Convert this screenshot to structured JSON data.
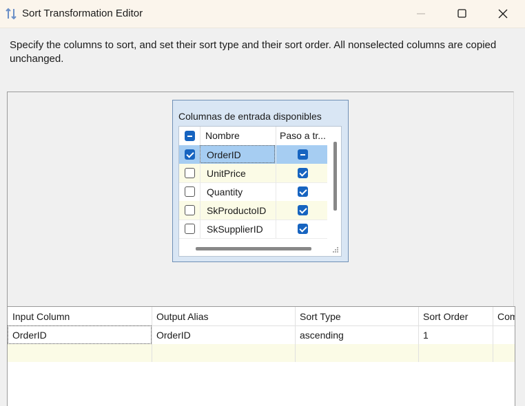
{
  "window": {
    "title": "Sort Transformation Editor"
  },
  "description": "Specify the columns to sort, and set their sort type and their sort order. All nonselected columns are copied unchanged.",
  "available_columns": {
    "title": "Columnas de entrada disponibles",
    "header_name": "Nombre",
    "header_pass": "Paso a tr...",
    "select_all_state": "indeterminate",
    "rows": [
      {
        "name": "OrderID",
        "checked": true,
        "pass_through": "indeterminate",
        "selected": true
      },
      {
        "name": "UnitPrice",
        "checked": false,
        "pass_through": "checked",
        "selected": false
      },
      {
        "name": "Quantity",
        "checked": false,
        "pass_through": "checked",
        "selected": false
      },
      {
        "name": "SkProductoID",
        "checked": false,
        "pass_through": "checked",
        "selected": false
      },
      {
        "name": "SkSupplierID",
        "checked": false,
        "pass_through": "checked",
        "selected": false
      }
    ]
  },
  "sort_grid": {
    "headers": [
      "Input Column",
      "Output Alias",
      "Sort Type",
      "Sort Order",
      "Com"
    ],
    "rows": [
      [
        "OrderID",
        "OrderID",
        "ascending",
        "1",
        ""
      ]
    ]
  },
  "colors": {
    "accent": "#1764c0",
    "selected_row": "#a6cdf2",
    "alt_row": "#fbfbe6",
    "title_bar": "#fbf5ec"
  }
}
